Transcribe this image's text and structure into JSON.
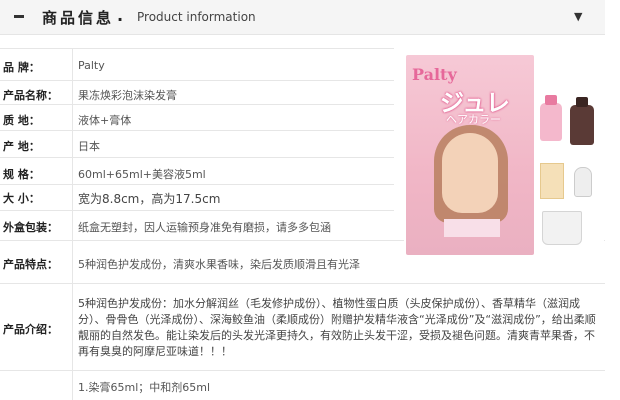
{
  "header": {
    "title_cn": "商品信息",
    "dot": ".",
    "title_en": "Product information",
    "arrow": "▼"
  },
  "rows": [
    {
      "label": "品    牌：",
      "value": "Palty"
    },
    {
      "label": "产品名称：",
      "value": "果冻焕彩泡沫染发膏"
    },
    {
      "label": "质    地：",
      "value": "液体+膏体"
    },
    {
      "label": "产    地：",
      "value": "日本"
    },
    {
      "label": "规    格：",
      "value": "60ml+65ml+美容液5ml"
    },
    {
      "label": "大    小：",
      "value": "宽为8.8cm，高为17.5cm"
    },
    {
      "label": "外盒包装：",
      "value": "纸盒无塑封，因人运输预身准免有磨损，请多多包涵"
    },
    {
      "label": "产品特点：",
      "value": "5种润色护发成份，清爽水果香味，染后发质顺滑且有光泽"
    },
    {
      "label": "产品介绍：",
      "value": ""
    },
    {
      "label": "",
      "value": "1.染膏65ml；中和剂65ml"
    }
  ],
  "description": "5种润色护发成份：加水分解润丝（毛发修护成份）、植物性蛋白质（头皮保护成份）、香草精华（滋润成分）、骨骨色（光泽成份）、深海鲛鱼油（柔顺成份）附赠护发精华液含“光泽成份”及“滋润成份”，给出柔顺靓丽的自然发色。能让染发后的头发光泽更持久，有效防止头发干涩，受损及褪色问题。清爽青苹果香，不再有臭臭的阿摩尼亚味道！！！",
  "product_image": {
    "brand": "Palty",
    "jp_title": "ジュレ",
    "jp_subtitle": "ヘアカラー"
  }
}
